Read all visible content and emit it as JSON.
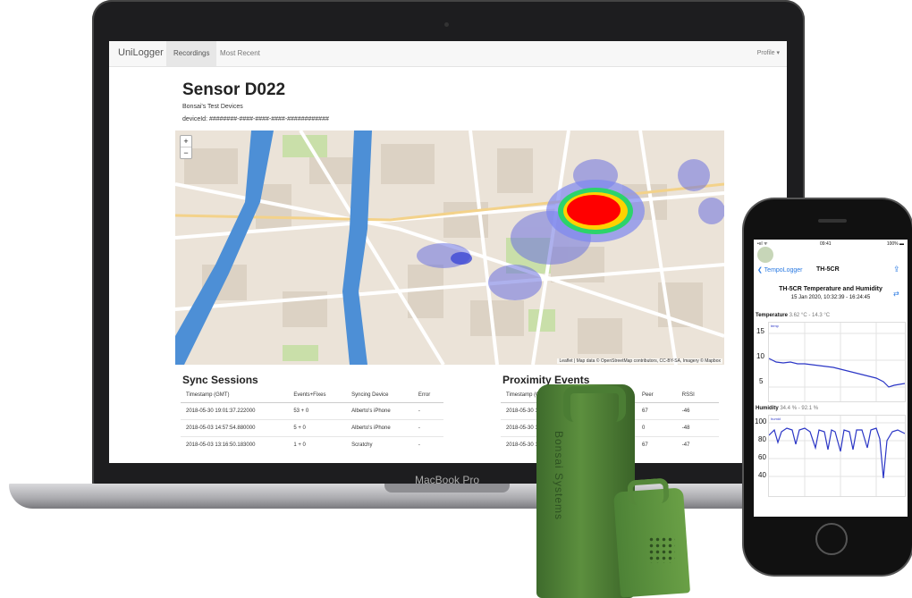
{
  "laptop": {
    "brand": "UniLogger",
    "nav_tabs": [
      "Recordings",
      "Most Recent"
    ],
    "profile_label": "Profile ▾",
    "page_title": "Sensor D022",
    "subtitle": "Bonsai's Test Devices",
    "device_id": "deviceId: ########-####-####-####-############",
    "map": {
      "zoom_in": "+",
      "zoom_out": "−",
      "attribution": "Leaflet | Map data © OpenStreetMap contributors, CC-BY-SA, Imagery © Mapbox"
    },
    "sync_sessions": {
      "title": "Sync Sessions",
      "columns": [
        "Timestamp (GMT)",
        "Events+Fixes",
        "Syncing Device",
        "Error"
      ],
      "rows": [
        [
          "2018-05-30 19:01:37.222000",
          "53 + 0",
          "Alberto's iPhone",
          "-"
        ],
        [
          "2018-05-03 14:57:54.880000",
          "5 + 0",
          "Alberto's iPhone",
          "-"
        ],
        [
          "2018-05-03 13:16:50.183000",
          "1 + 0",
          "Scratchy",
          "-"
        ]
      ]
    },
    "proximity_events": {
      "title": "Proximity Events",
      "columns": [
        "Timestamp (GM",
        "Peer",
        "RSSI"
      ],
      "rows": [
        [
          "2018-05-30 1",
          "67",
          "-46"
        ],
        [
          "2018-05-30 1",
          "0",
          "-48"
        ],
        [
          "2018-05-30 1",
          "67",
          "-47"
        ]
      ]
    },
    "macbook_label": "MacBook Pro"
  },
  "phone": {
    "status_left": "•ııl ᯤ",
    "status_time": "09:41",
    "status_right": "100% ▬",
    "back_label": "❮ TempoLogger",
    "nav_title": "TH-5CR",
    "share_icon": "⇪",
    "chart_title": "TH-5CR Temperature and Humidity",
    "date_range": "15 Jan 2020, 10:32:39 - 16:24:45",
    "temperature": {
      "label": "Temperature",
      "range": "3.62 °C - 14.3 °C",
      "legend": "temp",
      "ticks": [
        "15",
        "10",
        "5"
      ]
    },
    "humidity": {
      "label": "Humidity",
      "range": "34.4 % - 92.1 %",
      "legend": "humid",
      "ticks": [
        "100",
        "80",
        "60",
        "40"
      ]
    }
  },
  "device": {
    "engraving": "Bonsai Systems"
  },
  "colors": {
    "heat_core": "#ff0000",
    "heat_mid": "#ffd200",
    "heat_outer": "#4b5bd6",
    "river": "#4d8fd6",
    "device_green": "#4f8636",
    "chart_line": "#2b36c6"
  }
}
